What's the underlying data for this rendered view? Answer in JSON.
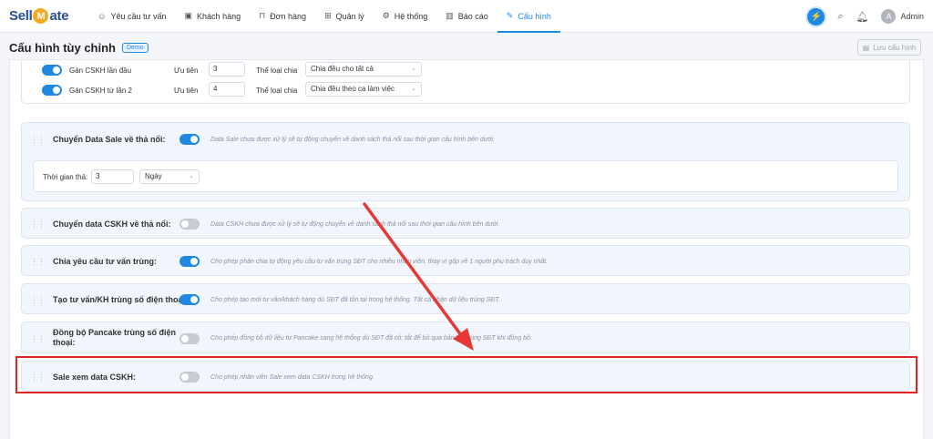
{
  "nav": {
    "logo_pre": "Sell",
    "logo_mid": "M",
    "logo_post": "ate",
    "items": [
      {
        "label": "Yêu cầu tư vấn",
        "icon": "chat-icon",
        "glyph": "☺"
      },
      {
        "label": "Khách hàng",
        "icon": "id-card-icon",
        "glyph": "▣"
      },
      {
        "label": "Đơn hàng",
        "icon": "cart-icon",
        "glyph": "⊓"
      },
      {
        "label": "Quản lý",
        "icon": "grid-icon",
        "glyph": "⊞"
      },
      {
        "label": "Hệ thống",
        "icon": "gear-icon",
        "glyph": "⚙"
      },
      {
        "label": "Báo cáo",
        "icon": "chart-icon",
        "glyph": "▥"
      },
      {
        "label": "Cấu hình",
        "icon": "wrench-icon",
        "glyph": "✎"
      }
    ],
    "active_index": 6,
    "user": "Admin",
    "avatar_letter": "A"
  },
  "header": {
    "title": "Cấu hình tùy chỉnh",
    "badge": "Demo",
    "save_label": "Lưu cấu hình"
  },
  "cskh_assign": [
    {
      "label": "Gán CSKH lần đầu",
      "priority_label": "Ưu tiên",
      "priority": "3",
      "type_label": "Thể loại chia",
      "type_value": "Chia đều cho tất cả"
    },
    {
      "label": "Gán CSKH từ lần 2",
      "priority_label": "Ưu tiên",
      "priority": "4",
      "type_label": "Thể loại chia",
      "type_value": "Chia đều theo ca làm việc"
    }
  ],
  "settings": [
    {
      "label": "Chuyển Data Sale về thả nổi:",
      "enabled": true,
      "desc": "Data Sale chưa được xử lý sẽ tự động chuyển về danh sách thả nổi sau thời gian cấu hình bên dưới."
    },
    {
      "label": "Chuyển data CSKH về thả nổi:",
      "enabled": false,
      "desc": "Data CSKH chưa được xử lý sẽ tự động chuyển về danh sách thả nổi sau thời gian cấu hình bên dưới."
    },
    {
      "label": "Chia yêu cầu tư vấn trùng:",
      "enabled": true,
      "desc": "Cho phép phân chia tự động yêu cầu tư vấn trùng SĐT cho nhiều nhân viên, thay vì gộp về 1 người phụ trách duy nhất."
    },
    {
      "label": "Tạo tư vấn/KH trùng số điện thoại:",
      "enabled": true,
      "desc": "Cho phép tạo mới tư vấn/khách hàng dù SĐT đã tồn tại trong hệ thống. Tất cả nhận dữ liệu trùng SĐT."
    },
    {
      "label": "Đồng bộ Pancake trùng số điện thoại:",
      "enabled": false,
      "desc": "Cho phép đồng bộ dữ liệu từ Pancake sang hệ thống dù SĐT đã có; tắt để bỏ qua bản ghi trùng SĐT khi đồng bộ."
    },
    {
      "label": "Sale xem data CSKH:",
      "enabled": false,
      "desc": "Cho phép nhân viên Sale xem data CSKH trong hệ thống."
    }
  ],
  "release_time": {
    "label": "Thời gian thả:",
    "value": "3",
    "unit": "Ngày"
  },
  "colors": {
    "accent": "#1e88e5",
    "highlight": "#e02424"
  }
}
